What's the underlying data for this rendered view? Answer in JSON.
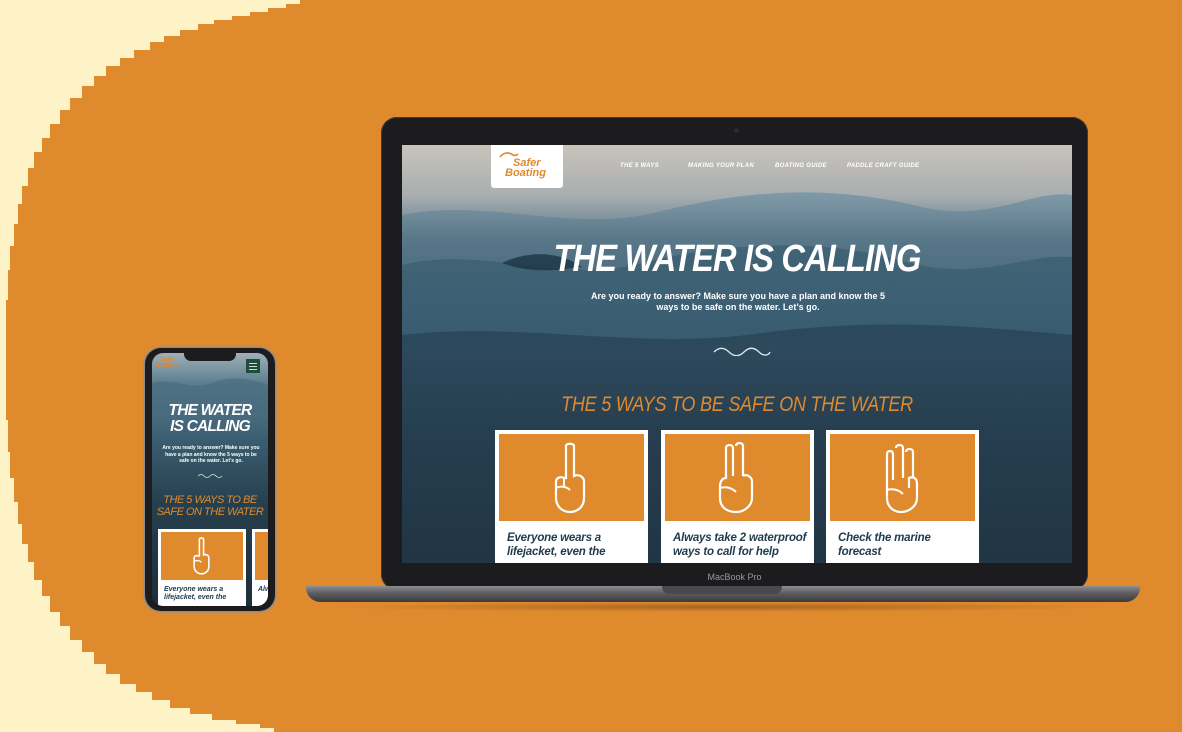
{
  "colors": {
    "accent": "#e08a2e",
    "background_pale": "#fdf3c6",
    "navy": "#1f3b4d"
  },
  "device_label": "MacBook Pro",
  "site": {
    "logo": {
      "line1": "Safer",
      "line2": "Boating"
    },
    "nav": [
      "THE 5 WAYS",
      "MAKING YOUR PLAN",
      "BOATING GUIDE",
      "PADDLE CRAFT GUIDE"
    ],
    "hero": {
      "title": "THE WATER IS CALLING",
      "subtitle": "Are you ready to answer? Make sure you have a plan and know the 5 ways to be safe on the water. Let’s go."
    },
    "ways_title": "THE 5 WAYS TO BE SAFE ON THE WATER",
    "cards": [
      {
        "text": "Everyone wears a lifejacket, even the",
        "icon": "one-finger-hand-icon"
      },
      {
        "text": "Always take 2 waterproof ways to call for help",
        "icon": "two-finger-hand-icon"
      },
      {
        "text": "Check the marine forecast",
        "icon": "three-finger-hand-icon"
      }
    ]
  },
  "mobile": {
    "title_line1": "THE WATER",
    "title_line2": "IS CALLING",
    "ways_line1": "THE 5 WAYS TO BE",
    "ways_line2": "SAFE ON THE WATER",
    "card_text": "Everyone wears a lifejacket, even the",
    "card2_peek": "Alw"
  }
}
